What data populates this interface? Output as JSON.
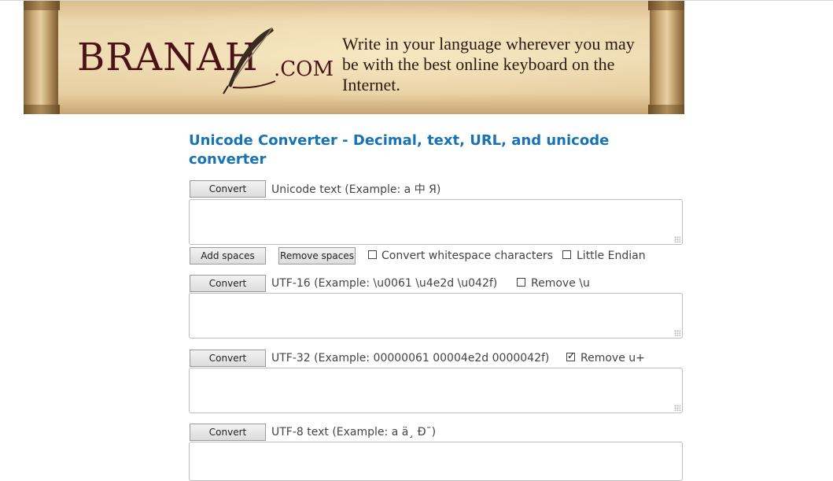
{
  "banner": {
    "logo_main": "BRANAH",
    "logo_suffix": ".COM",
    "tagline": "Write in your language wherever you may be with the best online keyboard on the Internet."
  },
  "page_title": "Unicode Converter - Decimal, text, URL, and unicode converter",
  "sections": {
    "unicode_text": {
      "button": "Convert",
      "label": "Unicode text (Example: a 中 Я)",
      "add_spaces": "Add spaces",
      "remove_spaces": "Remove spaces",
      "opt_whitespace": "Convert whitespace characters",
      "opt_whitespace_checked": false,
      "opt_endian": "Little Endian",
      "opt_endian_checked": false
    },
    "utf16": {
      "button": "Convert",
      "label": "UTF-16 (Example: \\u0061 \\u4e2d \\u042f)",
      "opt_remove": "Remove \\u",
      "opt_remove_checked": false
    },
    "utf32": {
      "button": "Convert",
      "label": "UTF-32 (Example: 00000061 00004e2d 0000042f)",
      "opt_remove": "Remove u+",
      "opt_remove_checked": true
    },
    "utf8": {
      "button": "Convert",
      "label": "UTF-8 text (Example: a ä¸ Ð¯)"
    }
  },
  "colors": {
    "title": "#1873b4",
    "logo": "#4a1416"
  }
}
